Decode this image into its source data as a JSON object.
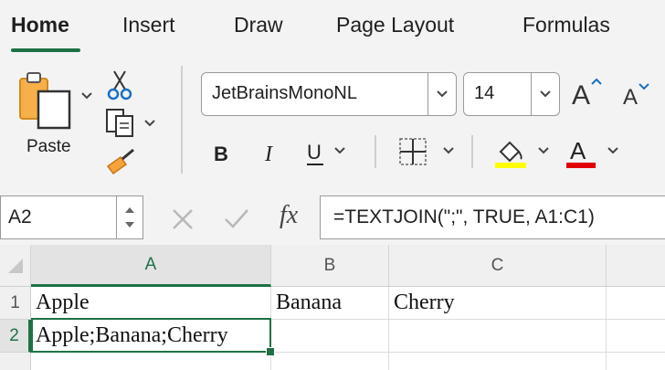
{
  "tabs": [
    "Home",
    "Insert",
    "Draw",
    "Page Layout",
    "Formulas"
  ],
  "active_tab": "Home",
  "clipboard": {
    "paste_label": "Paste"
  },
  "font": {
    "name": "JetBrainsMonoNL",
    "size": "14"
  },
  "formula_bar": {
    "name_box": "A2",
    "fx_label": "fx",
    "formula": "=TEXTJOIN(\";\", TRUE, A1:C1)"
  },
  "colors": {
    "accent": "#1e7145",
    "highlight": "#ffff00",
    "font_color": "#e00000"
  },
  "columns": [
    "A",
    "B",
    "C"
  ],
  "rows": [
    "1",
    "2"
  ],
  "cells": {
    "A1": "Apple",
    "B1": "Banana",
    "C1": "Cherry",
    "A2": "Apple;Banana;Cherry"
  },
  "selected_cell": "A2"
}
